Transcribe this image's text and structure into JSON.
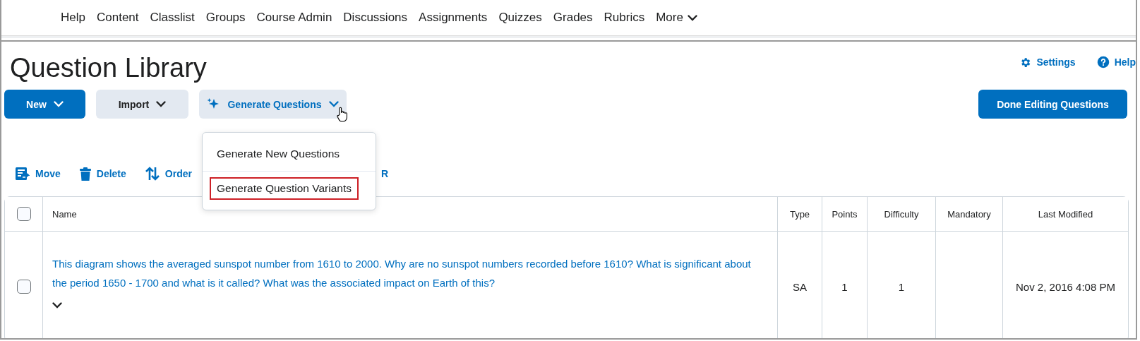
{
  "nav": {
    "items": [
      "Help",
      "Content",
      "Classlist",
      "Groups",
      "Course Admin",
      "Discussions",
      "Assignments",
      "Quizzes",
      "Grades",
      "Rubrics"
    ],
    "more": "More"
  },
  "page": {
    "title": "Question Library",
    "links": [
      {
        "kind": "settings",
        "label": "Settings"
      },
      {
        "kind": "help",
        "label": "Help"
      }
    ]
  },
  "buttons": [
    {
      "kind": "primary",
      "label": "New"
    },
    {
      "kind": "secondary",
      "label": "Import"
    },
    {
      "kind": "ai",
      "label": "Generate Questions"
    }
  ],
  "done_button": "Done Editing Questions",
  "menu": {
    "items": [
      {
        "label": "Generate New Questions",
        "highlighted": false
      },
      {
        "label": "Generate Question Variants",
        "highlighted": true
      }
    ]
  },
  "toolbar": [
    {
      "kind": "move",
      "label": "Move"
    },
    {
      "kind": "delete",
      "label": "Delete"
    },
    {
      "kind": "order",
      "label": "Order"
    },
    {
      "kind": "hidden",
      "label": "R"
    }
  ],
  "table": {
    "select_all": {
      "checked": false
    },
    "columns": [
      "Name",
      "Type",
      "Points",
      "Difficulty",
      "Mandatory",
      "Last Modified"
    ],
    "rows": [
      {
        "checked": false,
        "name": "This diagram shows the averaged sunspot number from 1610 to 2000. Why are no sunspot numbers recorded before 1610? What is significant about the period 1650 - 1700 and what is it called? What was the associated impact on Earth of this?",
        "type": "SA",
        "points": "1",
        "difficulty": "1",
        "last_modified": "Nov 2, 2016 4:08 PM"
      }
    ]
  }
}
